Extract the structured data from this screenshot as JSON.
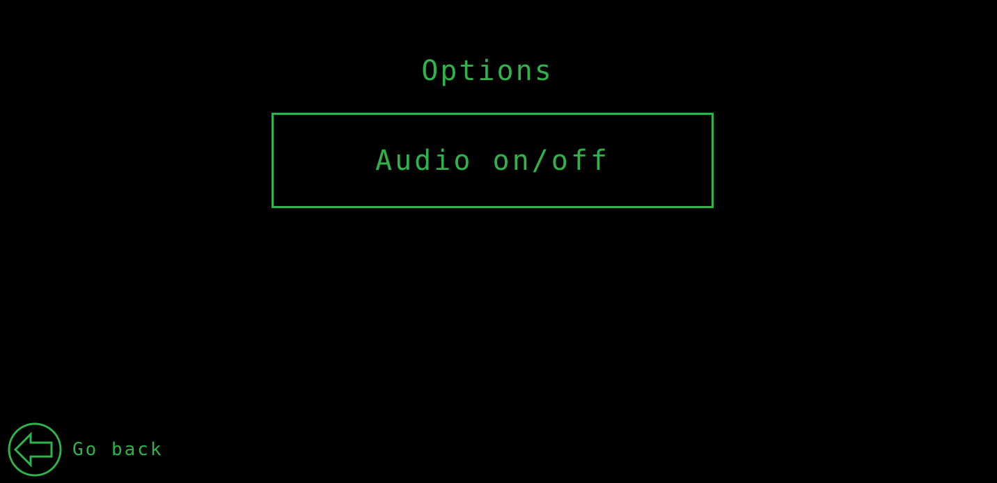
{
  "screen": {
    "title": "Options"
  },
  "menu": {
    "items": [
      {
        "label": "Audio on/off"
      }
    ]
  },
  "footer": {
    "back_label": "Go back",
    "back_icon": "back-arrow-icon"
  },
  "colors": {
    "background": "#000000",
    "accent": "#2fb34a"
  }
}
